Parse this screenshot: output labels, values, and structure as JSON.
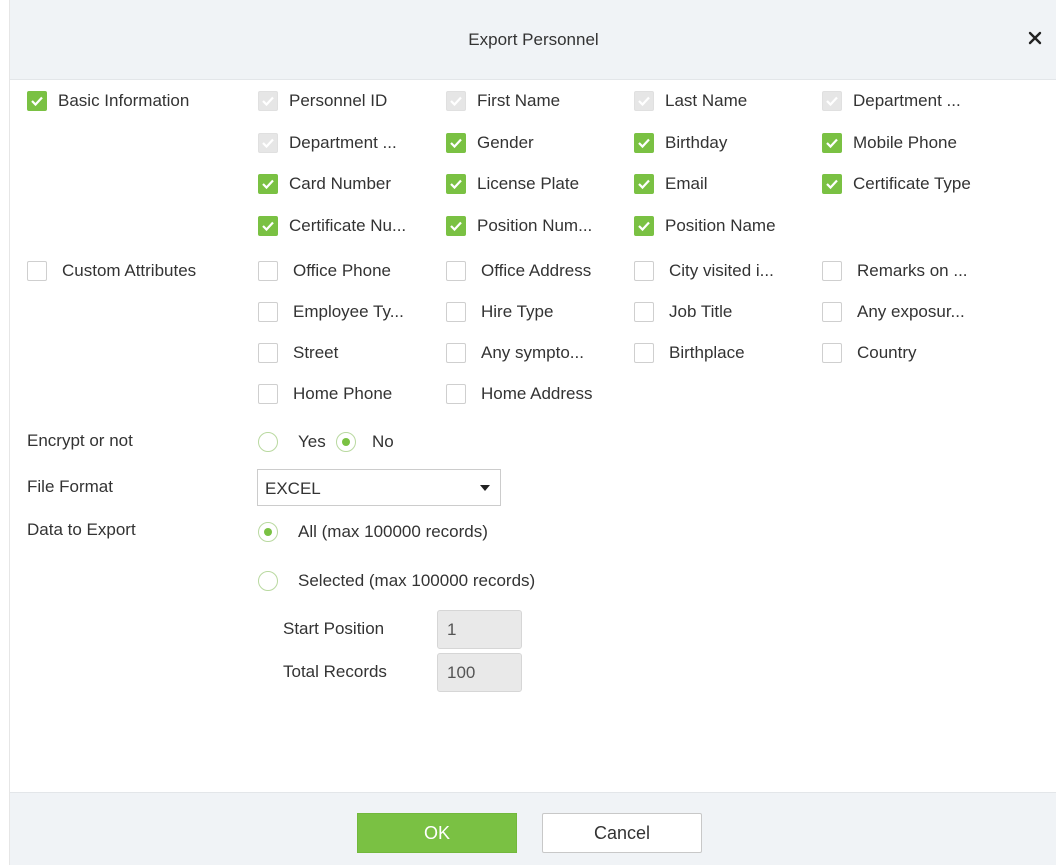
{
  "dialog": {
    "title": "Export Personnel",
    "close_icon": "close-icon"
  },
  "basic": {
    "label": "Basic Information",
    "checked": true,
    "fields": [
      {
        "label": "Personnel ID",
        "state": "disabled"
      },
      {
        "label": "First Name",
        "state": "disabled"
      },
      {
        "label": "Last Name",
        "state": "disabled"
      },
      {
        "label": "Department ...",
        "state": "disabled"
      },
      {
        "label": "Department ...",
        "state": "disabled"
      },
      {
        "label": "Gender",
        "state": "checked"
      },
      {
        "label": "Birthday",
        "state": "checked"
      },
      {
        "label": "Mobile Phone",
        "state": "checked"
      },
      {
        "label": "Card Number",
        "state": "checked"
      },
      {
        "label": "License Plate",
        "state": "checked"
      },
      {
        "label": "Email",
        "state": "checked"
      },
      {
        "label": "Certificate Type",
        "state": "checked"
      },
      {
        "label": "Certificate Nu...",
        "state": "checked"
      },
      {
        "label": "Position Num...",
        "state": "checked"
      },
      {
        "label": "Position Name",
        "state": "checked"
      }
    ]
  },
  "custom": {
    "label": "Custom Attributes",
    "checked": false,
    "fields": [
      {
        "label": "Office Phone",
        "state": "unchecked"
      },
      {
        "label": "Office Address",
        "state": "unchecked"
      },
      {
        "label": "City visited i...",
        "state": "unchecked"
      },
      {
        "label": "Remarks on ...",
        "state": "unchecked"
      },
      {
        "label": "Employee Ty...",
        "state": "unchecked"
      },
      {
        "label": "Hire Type",
        "state": "unchecked"
      },
      {
        "label": "Job Title",
        "state": "unchecked"
      },
      {
        "label": "Any exposur...",
        "state": "unchecked"
      },
      {
        "label": "Street",
        "state": "unchecked"
      },
      {
        "label": "Any sympto...",
        "state": "unchecked"
      },
      {
        "label": "Birthplace",
        "state": "unchecked"
      },
      {
        "label": "Country",
        "state": "unchecked"
      },
      {
        "label": "Home Phone",
        "state": "unchecked"
      },
      {
        "label": "Home Address",
        "state": "unchecked"
      }
    ]
  },
  "encrypt": {
    "label": "Encrypt or not",
    "options": [
      {
        "label": "Yes",
        "checked": false
      },
      {
        "label": "No",
        "checked": true
      }
    ]
  },
  "file_format": {
    "label": "File Format",
    "value": "EXCEL"
  },
  "data_export": {
    "label": "Data to Export",
    "options": [
      {
        "label": "All (max 100000 records)",
        "checked": true
      },
      {
        "label": "Selected (max 100000 records)",
        "checked": false
      }
    ],
    "start_label": "Start Position",
    "start_value": "1",
    "total_label": "Total Records",
    "total_value": "100"
  },
  "footer": {
    "ok_label": "OK",
    "cancel_label": "Cancel"
  },
  "colors": {
    "accent": "#7ac143",
    "header_bg": "#f0f3f6"
  }
}
